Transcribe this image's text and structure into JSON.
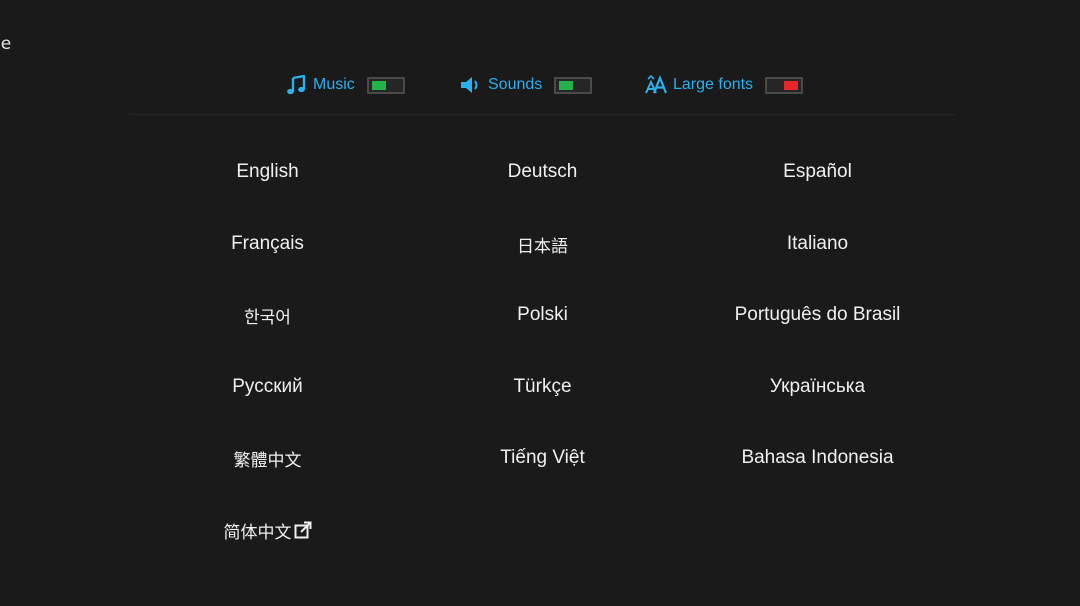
{
  "page": {
    "title": "ge"
  },
  "toggles": [
    {
      "label": "Music",
      "icon": "music-note-icon",
      "state": "on"
    },
    {
      "label": "Sounds",
      "icon": "speaker-icon",
      "state": "on"
    },
    {
      "label": "Large fonts",
      "icon": "font-size-icon",
      "state": "off"
    }
  ],
  "languages": [
    {
      "label": "English"
    },
    {
      "label": "Deutsch"
    },
    {
      "label": "Español"
    },
    {
      "label": "Français"
    },
    {
      "label": "日本語"
    },
    {
      "label": "Italiano"
    },
    {
      "label": "한국어"
    },
    {
      "label": "Polski"
    },
    {
      "label": "Português do Brasil"
    },
    {
      "label": "Русский"
    },
    {
      "label": "Türkçe"
    },
    {
      "label": "Українська"
    },
    {
      "label": "繁體中文"
    },
    {
      "label": "Tiếng Việt"
    },
    {
      "label": "Bahasa Indonesia"
    },
    {
      "label": "简体中文",
      "icon": "external-link-icon"
    }
  ],
  "colors": {
    "background": "#1a1a1a",
    "accent": "#2ab0ee",
    "switch_on": "#25b24a",
    "switch_off": "#e8262a",
    "text": "#f0f0f0"
  }
}
